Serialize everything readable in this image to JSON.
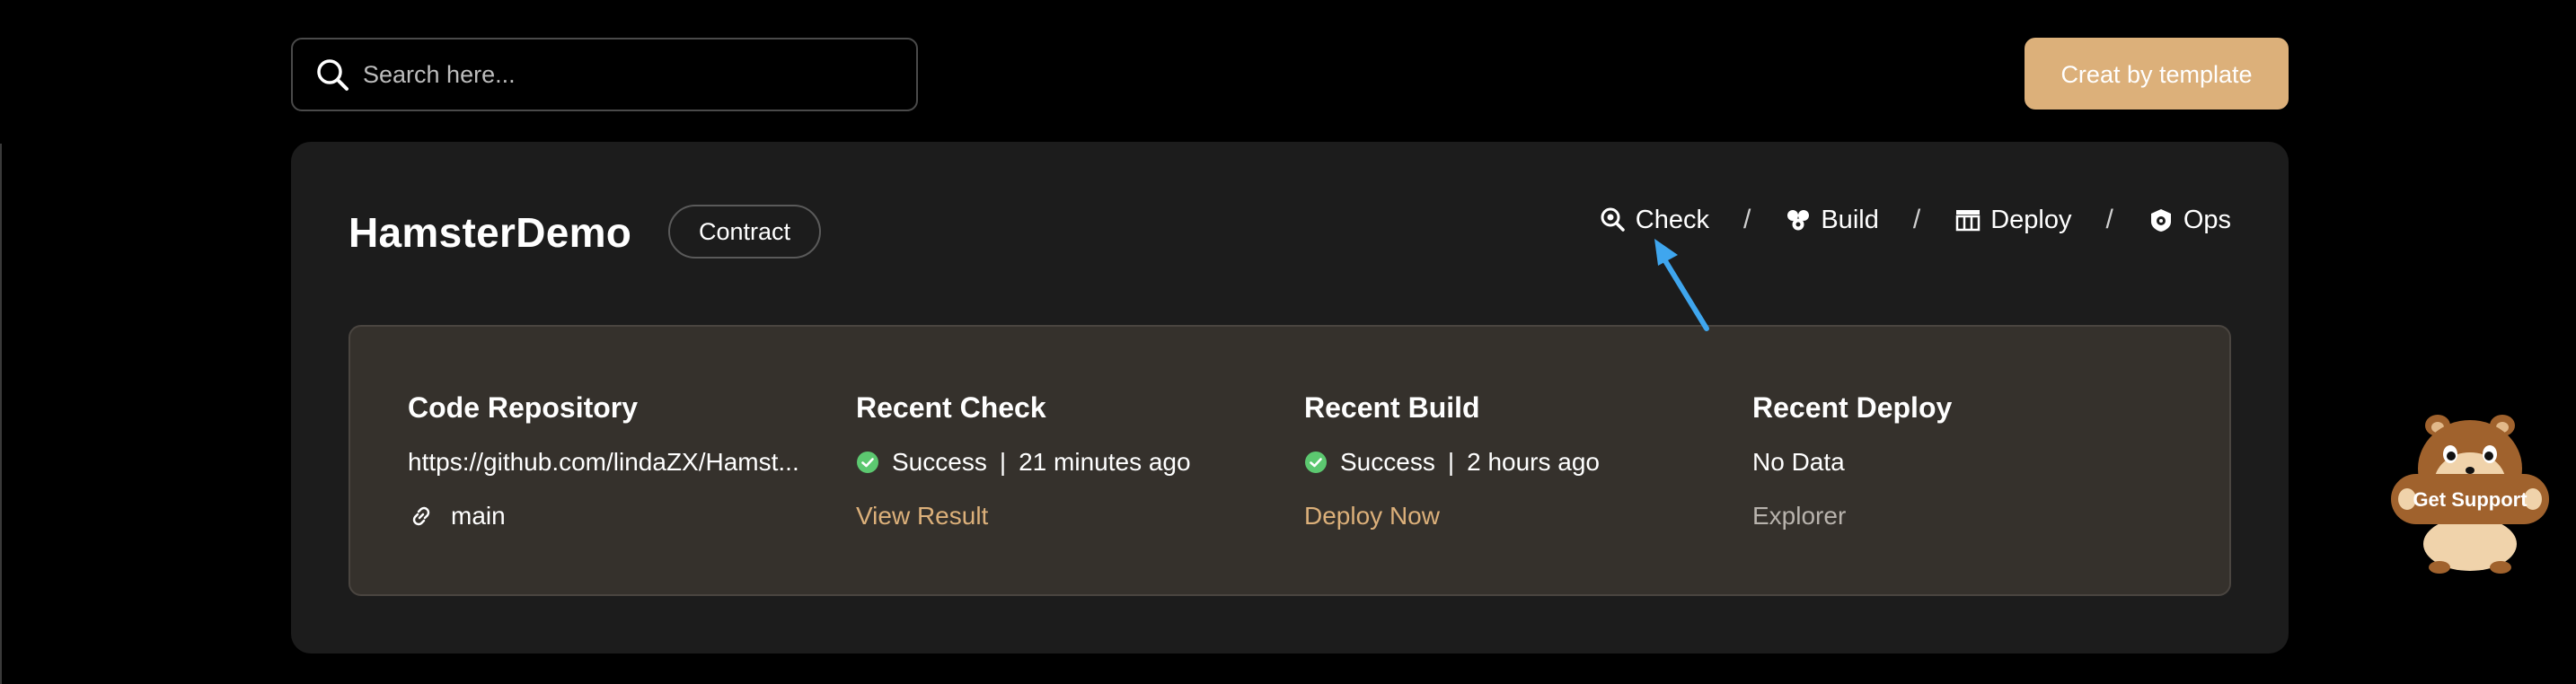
{
  "search": {
    "placeholder": "Search here..."
  },
  "header": {
    "create_label": "Creat by template"
  },
  "project": {
    "name": "HamsterDemo",
    "tag": "Contract",
    "steps": [
      "Check",
      "Build",
      "Deploy",
      "Ops"
    ],
    "separator": "/"
  },
  "summary": {
    "repo": {
      "title": "Code Repository",
      "url": "https://github.com/lindaZX/Hamst...",
      "branch": "main"
    },
    "check": {
      "title": "Recent Check",
      "status": "Success",
      "time": "21 minutes ago",
      "action": "View Result"
    },
    "build": {
      "title": "Recent Build",
      "status": "Success",
      "time": "2 hours ago",
      "action": "Deploy Now"
    },
    "deploy": {
      "title": "Recent Deploy",
      "status": "No Data",
      "action": "Explorer"
    }
  },
  "support": {
    "label": "Get Support"
  },
  "colors": {
    "accent": "#dcb07a",
    "success": "#5cc870",
    "arrow": "#3fa6ee",
    "card": "#1c1c1c",
    "panel": "#35312c"
  },
  "icons": [
    "search-icon",
    "check-icon",
    "build-icon",
    "deploy-icon",
    "ops-icon",
    "success-icon",
    "link-icon"
  ]
}
